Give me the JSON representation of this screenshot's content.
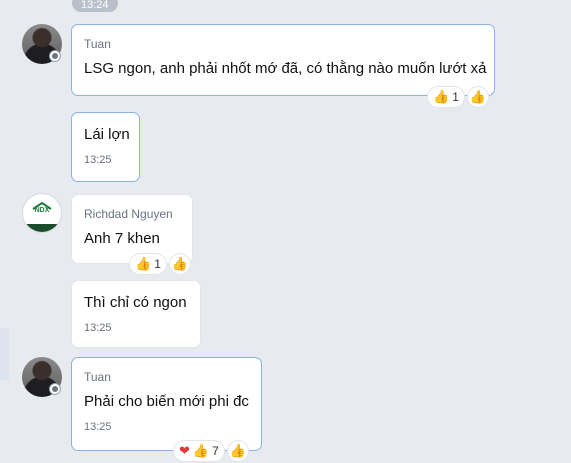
{
  "divider": {
    "time": "13:24"
  },
  "messages": [
    {
      "sender": "Tuan",
      "text": "LSG ngon, anh phải nhốt mớ đã, có thằng nào muốn lướt xả",
      "reaction_icons": [
        "thumbs-up-icon"
      ],
      "reaction_count": "1"
    },
    {
      "text": "Lái lợn",
      "time": "13:25"
    },
    {
      "sender": "Richdad Nguyen",
      "text": "Anh 7 khen",
      "reaction_icons": [
        "thumbs-up-icon"
      ],
      "reaction_count": "1"
    },
    {
      "text": "Thì chỉ có ngon",
      "time": "13:25"
    },
    {
      "sender": "Tuan",
      "text": "Phải cho biến mới phi đc",
      "time": "13:25",
      "reaction_icons": [
        "heart-icon",
        "thumbs-up-icon"
      ],
      "reaction_count": "7"
    }
  ],
  "avatars": {
    "ndx_logo_text": "NDX"
  },
  "colors": {
    "background": "#e7eaef",
    "bubble": "#ffffff",
    "selected_border": "#8fb0e3",
    "heart": "#e5383b"
  }
}
